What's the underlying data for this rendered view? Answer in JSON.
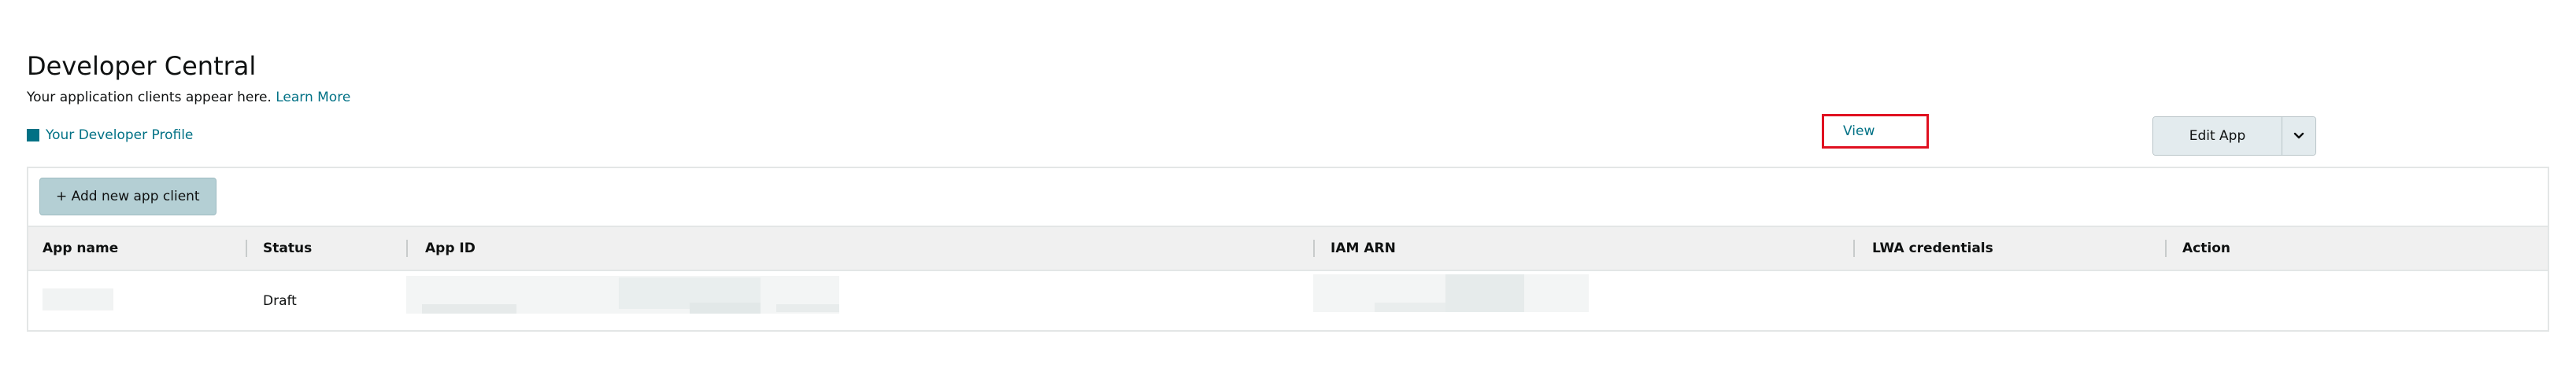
{
  "page": {
    "title": "Developer Central",
    "subtitle_text": "Your application clients appear here.",
    "learn_more": "Learn More",
    "profile_link": "Your Developer Profile"
  },
  "toolbar": {
    "add_button": "+ Add new app client"
  },
  "table": {
    "headers": [
      "App name",
      "Status",
      "App ID",
      "IAM ARN",
      "LWA credentials",
      "Action"
    ],
    "rows": [
      {
        "status": "Draft",
        "lwa_credentials": "View",
        "action": "Edit App"
      }
    ]
  },
  "icons": {
    "dropdown": "chevron-down-icon",
    "profile": "square-icon"
  },
  "colors": {
    "link": "#007185",
    "highlight_border": "#e01020",
    "add_button_bg": "#b4cfd4"
  }
}
